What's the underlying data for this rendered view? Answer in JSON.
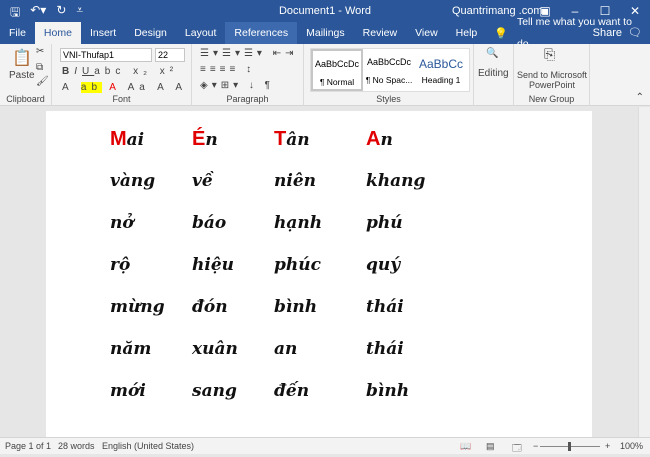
{
  "window": {
    "title": "Document1 - Word",
    "account": "Quantrimang .com"
  },
  "tabs": [
    "File",
    "Home",
    "Insert",
    "Design",
    "Layout",
    "References",
    "Mailings",
    "Review",
    "View",
    "Help"
  ],
  "tell_me": "Tell me what you want to do",
  "share": "Share",
  "ribbon": {
    "paste": "Paste",
    "clipboard": "Clipboard",
    "font_name": "VNI-Thufap1",
    "font_size": "22",
    "font": "Font",
    "paragraph": "Paragraph",
    "styles": [
      {
        "preview": "AaBbCcDc",
        "name": "¶ Normal"
      },
      {
        "preview": "AaBbCcDc",
        "name": "¶ No Spac..."
      },
      {
        "preview": "AaBbCc",
        "name": "Heading 1"
      }
    ],
    "styles_label": "Styles",
    "editing": "Editing",
    "send": "Send to Microsoft PowerPoint",
    "new_group": "New Group"
  },
  "document": {
    "rows": [
      [
        {
          "first": "M",
          "rest": "ai"
        },
        {
          "first": "É",
          "rest": "n"
        },
        {
          "first": "T",
          "rest": "ân"
        },
        {
          "first": "A",
          "rest": "n"
        }
      ],
      [
        "vàng",
        "về",
        "niên",
        "khang"
      ],
      [
        "nở",
        "báo",
        "hạnh",
        "phú"
      ],
      [
        "rộ",
        "hiệu",
        "phúc",
        "quý"
      ],
      [
        "mừng",
        "đón",
        "bình",
        "thái"
      ],
      [
        "năm",
        "xuân",
        "an",
        "thái"
      ],
      [
        "mới",
        "sang",
        "đến",
        "bình"
      ]
    ],
    "accent": "#e00000"
  },
  "status": {
    "page": "Page 1 of 1",
    "words": "28 words",
    "language": "English (United States)",
    "zoom": "100%"
  }
}
